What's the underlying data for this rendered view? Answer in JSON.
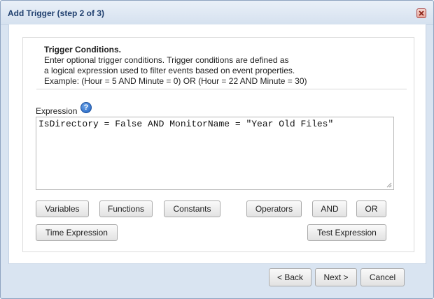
{
  "dialog": {
    "title": "Add Trigger (step 2 of 3)"
  },
  "info": {
    "heading": "Trigger Conditions.",
    "line1": "Enter optional trigger conditions. Trigger conditions are defined as",
    "line2": "a logical expression used to filter events based on event properties.",
    "line3": "Example: (Hour = 5 AND Minute = 0) OR (Hour = 22 AND Minute = 30)"
  },
  "expression": {
    "label": "Expression",
    "value": "IsDirectory = False AND MonitorName = \"Year Old Files\""
  },
  "buttons": {
    "variables": "Variables",
    "functions": "Functions",
    "constants": "Constants",
    "operators": "Operators",
    "and": "AND",
    "or": "OR",
    "time_expression": "Time Expression",
    "test_expression": "Test Expression"
  },
  "footer": {
    "back": "< Back",
    "next": "Next >",
    "cancel": "Cancel"
  },
  "icons": {
    "close": "close-icon",
    "help": "help-icon",
    "resize": "resize-grip-icon"
  }
}
